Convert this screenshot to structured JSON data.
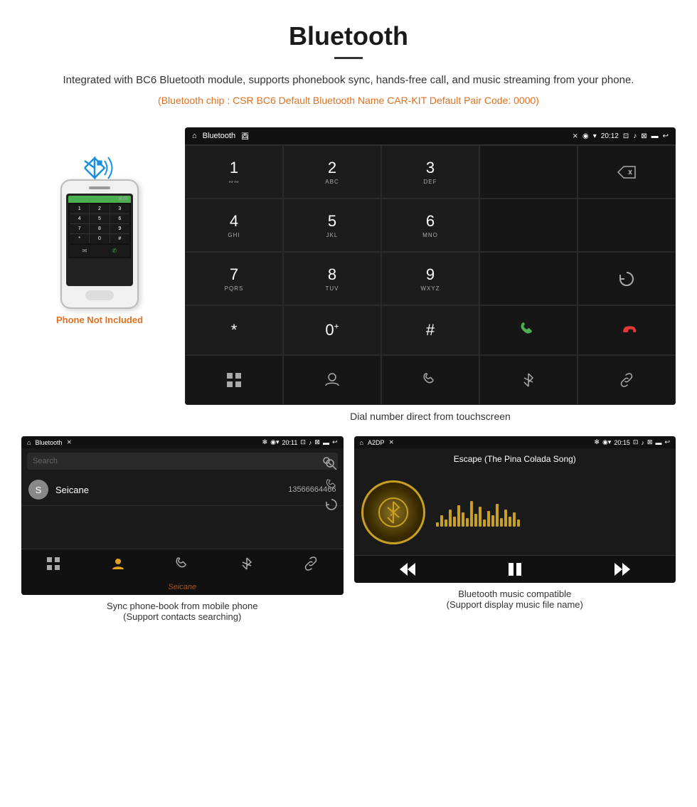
{
  "header": {
    "title": "Bluetooth",
    "description": "Integrated with BC6 Bluetooth module, supports phonebook sync, hands-free call, and music streaming from your phone.",
    "specs": "(Bluetooth chip : CSR BC6    Default Bluetooth Name CAR-KIT    Default Pair Code: 0000)"
  },
  "phone_label": "Phone Not Included",
  "dial_screen": {
    "status_bar": {
      "app_name": "Bluetooth",
      "time": "20:12"
    },
    "keys": [
      {
        "main": "1",
        "sub": ""
      },
      {
        "main": "2",
        "sub": "ABC"
      },
      {
        "main": "3",
        "sub": "DEF"
      },
      {
        "main": "",
        "sub": ""
      },
      {
        "main": "⌫",
        "sub": ""
      },
      {
        "main": "4",
        "sub": "GHI"
      },
      {
        "main": "5",
        "sub": "JKL"
      },
      {
        "main": "6",
        "sub": "MNO"
      },
      {
        "main": "",
        "sub": ""
      },
      {
        "main": "",
        "sub": ""
      },
      {
        "main": "7",
        "sub": "PQRS"
      },
      {
        "main": "8",
        "sub": "TUV"
      },
      {
        "main": "9",
        "sub": "WXYZ"
      },
      {
        "main": "",
        "sub": ""
      },
      {
        "main": "↺",
        "sub": ""
      },
      {
        "main": "*",
        "sub": ""
      },
      {
        "main": "0",
        "sub": "+"
      },
      {
        "main": "#",
        "sub": ""
      },
      {
        "main": "✆",
        "sub": "green"
      },
      {
        "main": "",
        "sub": ""
      },
      {
        "main": "⊞",
        "sub": ""
      },
      {
        "main": "👤",
        "sub": ""
      },
      {
        "main": "✆",
        "sub": ""
      },
      {
        "main": "✻",
        "sub": ""
      },
      {
        "main": "🔗",
        "sub": ""
      }
    ]
  },
  "dial_caption": "Dial number direct from touchscreen",
  "phonebook_screen": {
    "status_bar": {
      "app_name": "Bluetooth",
      "time": "20:11"
    },
    "search_placeholder": "Search",
    "contacts": [
      {
        "initial": "S",
        "name": "Seicane",
        "number": "13566664466"
      }
    ]
  },
  "phonebook_caption_line1": "Sync phone-book from mobile phone",
  "phonebook_caption_line2": "(Support contacts searching)",
  "music_screen": {
    "status_bar": {
      "app_name": "A2DP",
      "time": "20:15"
    },
    "song_title": "Escape (The Pina Colada Song)",
    "visualizer_bars": [
      3,
      8,
      5,
      12,
      7,
      15,
      10,
      6,
      18,
      9,
      14,
      5,
      11,
      8,
      16,
      6,
      12,
      7,
      10,
      5
    ]
  },
  "music_caption_line1": "Bluetooth music compatible",
  "music_caption_line2": "(Support display music file name)"
}
